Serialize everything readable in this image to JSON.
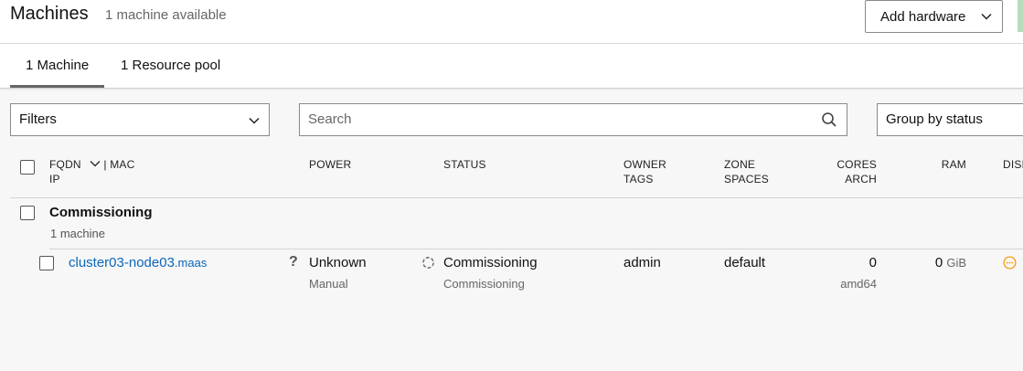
{
  "header": {
    "title": "Machines",
    "subtitle": "1 machine available",
    "add_hardware_label": "Add hardware"
  },
  "tabs": [
    {
      "label": "1 Machine",
      "active": true
    },
    {
      "label": "1 Resource pool",
      "active": false
    }
  ],
  "toolbar": {
    "filters_label": "Filters",
    "search_placeholder": "Search",
    "group_by_label": "Group by status"
  },
  "table": {
    "headers": {
      "fqdn": "FQDN",
      "mac": "| MAC",
      "ip": "IP",
      "power": "POWER",
      "status": "STATUS",
      "owner": "OWNER",
      "tags": "TAGS",
      "zone": "ZONE",
      "spaces": "SPACES",
      "cores": "CORES",
      "arch": "ARCH",
      "ram": "RAM",
      "disks": "DISKS"
    },
    "group": {
      "title": "Commissioning",
      "count": "1 machine"
    },
    "rows": [
      {
        "hostname": "cluster03-node03",
        "domain": ".maas",
        "power_state": "Unknown",
        "power_type": "Manual",
        "status": "Commissioning",
        "status_detail": "Commissioning",
        "owner": "admin",
        "zone": "default",
        "cores": "0",
        "arch": "amd64",
        "ram": "0",
        "ram_unit": "GiB"
      }
    ]
  },
  "colors": {
    "link": "#0b66b8",
    "warning": "#f99b11",
    "accent_green": "#b7dcbc"
  }
}
